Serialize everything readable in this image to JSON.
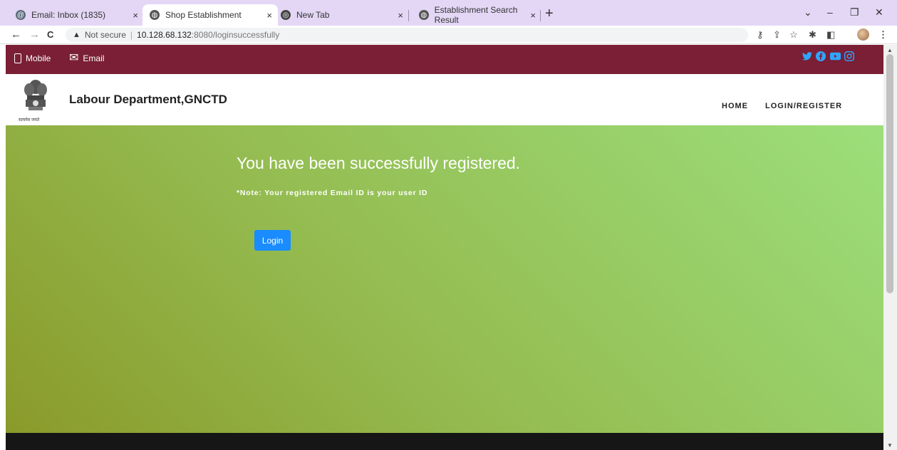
{
  "browser": {
    "tabs": [
      {
        "title": "Email: Inbox (1835)",
        "close": "×"
      },
      {
        "title": "Shop Establishment",
        "close": "×"
      },
      {
        "title": "New Tab",
        "close": "×"
      },
      {
        "title": "Establishment Search Result",
        "close": "×"
      }
    ],
    "new_tab": "+",
    "window_controls": {
      "dropdown": "⌄",
      "minimize": "–",
      "restore": "❐",
      "close": "✕"
    },
    "nav": {
      "back": "←",
      "forward": "→",
      "reload": "C"
    },
    "address": {
      "security_label": "Not secure",
      "host": "10.128.68.132",
      "path": ":8080/loginsuccessfully"
    }
  },
  "site": {
    "topbar": {
      "mobile_label": "Mobile",
      "email_label": "Email"
    },
    "brand": "Labour Department,GNCTD",
    "emblem_caption": "सत्यमेव जयते",
    "nav": {
      "home": "HOME",
      "login_register": "LOGIN/REGISTER"
    },
    "hero": {
      "title": "You have been successfully registered.",
      "note": "*Note: Your registered Email ID is your user ID",
      "login_button": "Login"
    }
  },
  "colors": {
    "topbar_bg": "#7a1f35",
    "social_icons": "#2ea6ff",
    "button": "#1a8cff",
    "hero_gradient": [
      "#8a9a2a",
      "#9cdf7b"
    ]
  },
  "icons": [
    "gmail-icon",
    "globe-icon",
    "chrome-icon",
    "warning-icon",
    "key-icon",
    "share-icon",
    "star-icon",
    "extensions-icon",
    "sidepanel-icon",
    "menu-icon",
    "phone-icon",
    "mail-icon",
    "twitter-icon",
    "facebook-icon",
    "youtube-icon",
    "instagram-icon"
  ]
}
